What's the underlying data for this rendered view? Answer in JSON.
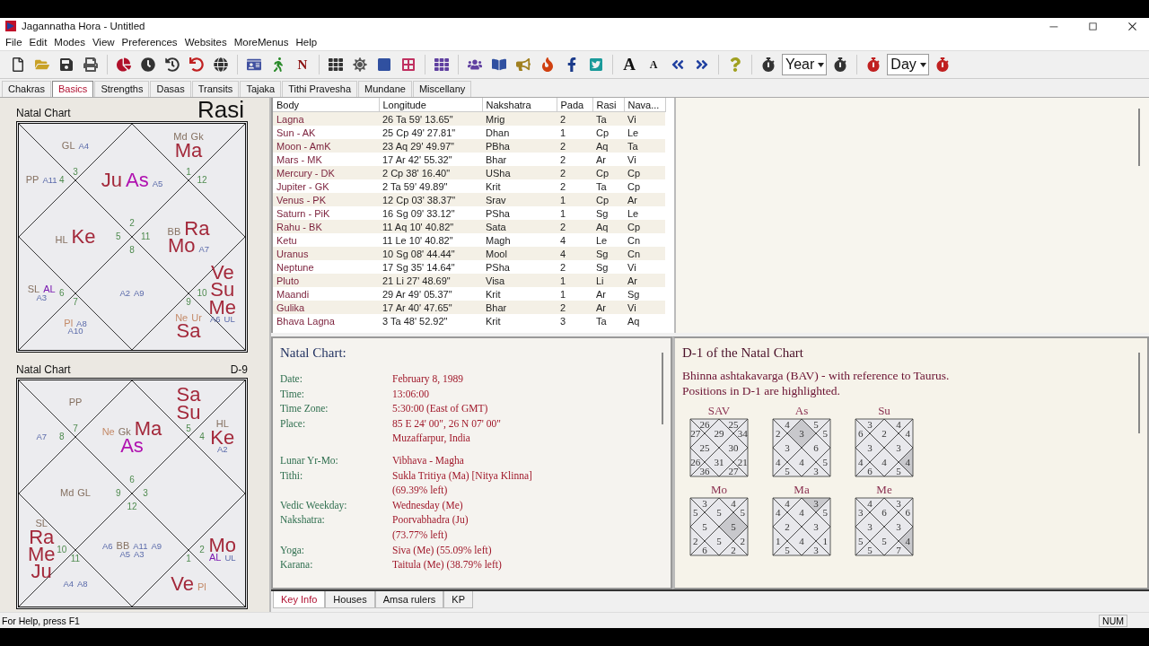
{
  "window": {
    "title": "Jagannatha Hora - Untitled"
  },
  "menu": [
    "File",
    "Edit",
    "Modes",
    "View",
    "Preferences",
    "Websites",
    "MoreMenus",
    "Help"
  ],
  "toolbar": {
    "letter_buttons": [
      "N",
      "A",
      "A"
    ],
    "selects": [
      "Year",
      "Day"
    ]
  },
  "tabs": [
    {
      "label": "Chakras",
      "selected": false
    },
    {
      "label": "Basics",
      "selected": true
    },
    {
      "label": "Strengths",
      "selected": false
    },
    {
      "label": "Dasas",
      "selected": false
    },
    {
      "label": "Transits",
      "selected": false
    },
    {
      "label": "Tajaka",
      "selected": false
    },
    {
      "label": "Tithi Pravesha",
      "selected": false
    },
    {
      "label": "Mundane",
      "selected": false
    },
    {
      "label": "Miscellany",
      "selected": false
    }
  ],
  "charts": [
    {
      "title": "Natal Chart",
      "label": "Rasi",
      "kind": "rasi",
      "houses": {
        "house_1": {
          "sign": "2",
          "items": [
            {
              "text": "Ju",
              "kind": "planet"
            },
            {
              "text": "As",
              "kind": "lagna"
            },
            {
              "text": "A5",
              "kind": "arudha"
            }
          ]
        },
        "house_2": {
          "sign": "3",
          "items": [
            {
              "text": "GL",
              "kind": "special"
            },
            {
              "text": "A4",
              "kind": "arudha"
            }
          ]
        },
        "house_3": {
          "sign": "4",
          "items": [
            {
              "text": "PP",
              "kind": "special"
            },
            {
              "text": "A11",
              "kind": "arudha"
            }
          ]
        },
        "house_4": {
          "sign": "5",
          "items": [
            {
              "text": "HL",
              "kind": "special"
            },
            {
              "text": "Ke",
              "kind": "planet"
            }
          ]
        },
        "house_5": {
          "sign": "6",
          "items": [
            {
              "text": "SL",
              "kind": "special"
            },
            {
              "text": "AL",
              "kind": "al"
            },
            {
              "text": "A3",
              "kind": "arudha"
            }
          ]
        },
        "house_6": {
          "sign": "7",
          "items": [
            {
              "text": "Pl",
              "kind": "outer"
            },
            {
              "text": "A8",
              "kind": "arudha"
            },
            {
              "text": "A10",
              "kind": "arudha"
            }
          ]
        },
        "house_7": {
          "sign": "8",
          "items": [
            {
              "text": "A2",
              "kind": "arudha"
            },
            {
              "text": "A9",
              "kind": "arudha"
            }
          ]
        },
        "house_8": {
          "sign": "9",
          "items": [
            {
              "text": "Ne",
              "kind": "outer"
            },
            {
              "text": "Ur",
              "kind": "outer"
            },
            {
              "text": "Sa",
              "kind": "planet"
            }
          ]
        },
        "house_9": {
          "sign": "10",
          "items": [
            {
              "text": "Ve",
              "kind": "planet"
            },
            {
              "text": "Su",
              "kind": "planet"
            },
            {
              "text": "Me",
              "kind": "planet"
            },
            {
              "text": "A6",
              "kind": "arudha"
            },
            {
              "text": "UL",
              "kind": "arudha"
            }
          ]
        },
        "house_10": {
          "sign": "11",
          "items": [
            {
              "text": "BB",
              "kind": "special"
            },
            {
              "text": "Ra",
              "kind": "planet"
            },
            {
              "text": "Mo",
              "kind": "planet"
            },
            {
              "text": "A7",
              "kind": "arudha"
            }
          ]
        },
        "house_11": {
          "sign": "12"
        },
        "house_12": {
          "sign": "1",
          "items": [
            {
              "text": "Md",
              "kind": "special"
            },
            {
              "text": "Gk",
              "kind": "special"
            },
            {
              "text": "Ma",
              "kind": "planet"
            }
          ]
        }
      }
    },
    {
      "title": "Natal Chart",
      "label": "D-9",
      "kind": "varga",
      "houses": {
        "house_1": {
          "sign": "6",
          "items": [
            {
              "text": "Ne",
              "kind": "outer"
            },
            {
              "text": "Gk",
              "kind": "special"
            },
            {
              "text": "Ma",
              "kind": "planet"
            },
            {
              "text": "As",
              "kind": "lagna"
            }
          ]
        },
        "house_2": {
          "sign": "7",
          "items": [
            {
              "text": "PP",
              "kind": "special"
            }
          ]
        },
        "house_3": {
          "sign": "8",
          "items": [
            {
              "text": "A7",
              "kind": "arudha"
            }
          ]
        },
        "house_4": {
          "sign": "9",
          "items": [
            {
              "text": "Md",
              "kind": "special"
            },
            {
              "text": "GL",
              "kind": "special"
            }
          ]
        },
        "house_5": {
          "sign": "10",
          "items": [
            {
              "text": "SL",
              "kind": "special"
            },
            {
              "text": "Ra",
              "kind": "planet"
            },
            {
              "text": "Me",
              "kind": "planet"
            },
            {
              "text": "Ju",
              "kind": "planet"
            }
          ]
        },
        "house_6": {
          "sign": "11",
          "items": [
            {
              "text": "A4",
              "kind": "arudha"
            },
            {
              "text": "A8",
              "kind": "arudha"
            }
          ]
        },
        "house_7": {
          "sign": "12",
          "items": [
            {
              "text": "A6",
              "kind": "arudha"
            },
            {
              "text": "BB",
              "kind": "special"
            },
            {
              "text": "A11",
              "kind": "arudha"
            },
            {
              "text": "A9",
              "kind": "arudha"
            },
            {
              "text": "A5",
              "kind": "arudha"
            },
            {
              "text": "A3",
              "kind": "arudha"
            }
          ]
        },
        "house_8": {
          "sign": "1",
          "items": [
            {
              "text": "Ve",
              "kind": "planet"
            },
            {
              "text": "Pl",
              "kind": "outer"
            }
          ]
        },
        "house_9": {
          "sign": "2",
          "items": [
            {
              "text": "Mo",
              "kind": "planet"
            },
            {
              "text": "AL",
              "kind": "al"
            },
            {
              "text": "UL",
              "kind": "arudha"
            }
          ]
        },
        "house_10": {
          "sign": "3"
        },
        "house_11": {
          "sign": "4",
          "items": [
            {
              "text": "HL",
              "kind": "special"
            },
            {
              "text": "Ke",
              "kind": "planet"
            },
            {
              "text": "A2",
              "kind": "arudha"
            }
          ]
        },
        "house_12": {
          "sign": "5",
          "items": [
            {
              "text": "Sa",
              "kind": "planet"
            },
            {
              "text": "Su",
              "kind": "planet"
            }
          ]
        }
      }
    }
  ],
  "planet_table": {
    "columns": [
      "Body",
      "Longitude",
      "Nakshatra",
      "Pada",
      "Rasi",
      "Nava..."
    ],
    "rows": [
      [
        "Lagna",
        "26 Ta 59' 13.65\"",
        "Mrig",
        "2",
        "Ta",
        "Vi"
      ],
      [
        "Sun - AK",
        "25 Cp 49' 27.81\"",
        "Dhan",
        "1",
        "Cp",
        "Le"
      ],
      [
        "Moon - AmK",
        "23 Aq 29' 49.97\"",
        "PBha",
        "2",
        "Aq",
        "Ta"
      ],
      [
        "Mars - MK",
        "17 Ar 42' 55.32\"",
        "Bhar",
        "2",
        "Ar",
        "Vi"
      ],
      [
        "Mercury - DK",
        "2 Cp 38' 16.40\"",
        "USha",
        "2",
        "Cp",
        "Cp"
      ],
      [
        "Jupiter - GK",
        "2 Ta 59' 49.89\"",
        "Krit",
        "2",
        "Ta",
        "Cp"
      ],
      [
        "Venus - PK",
        "12 Cp 03' 38.37\"",
        "Srav",
        "1",
        "Cp",
        "Ar"
      ],
      [
        "Saturn - PiK",
        "16 Sg 09' 33.12\"",
        "PSha",
        "1",
        "Sg",
        "Le"
      ],
      [
        "Rahu - BK",
        "11 Aq 10' 40.82\"",
        "Sata",
        "2",
        "Aq",
        "Cp"
      ],
      [
        "Ketu",
        "11 Le 10' 40.82\"",
        "Magh",
        "4",
        "Le",
        "Cn"
      ],
      [
        "Uranus",
        "10 Sg 08' 44.44\"",
        "Mool",
        "4",
        "Sg",
        "Cn"
      ],
      [
        "Neptune",
        "17 Sg 35' 14.64\"",
        "PSha",
        "2",
        "Sg",
        "Vi"
      ],
      [
        "Pluto",
        "21 Li 27' 48.69\"",
        "Visa",
        "1",
        "Li",
        "Ar"
      ],
      [
        "Maandi",
        "29 Ar 49' 05.37\"",
        "Krit",
        "1",
        "Ar",
        "Sg"
      ],
      [
        "Gulika",
        "17 Ar 40' 47.65\"",
        "Bhar",
        "2",
        "Ar",
        "Vi"
      ],
      [
        "Bhava Lagna",
        "3 Ta 48' 52.92\"",
        "Krit",
        "3",
        "Ta",
        "Aq"
      ]
    ]
  },
  "key_info": {
    "title": "Natal Chart:",
    "groups": [
      [
        {
          "label": "Date:",
          "lines": [
            "February 8, 1989"
          ]
        },
        {
          "label": "Time:",
          "lines": [
            "13:06:00"
          ]
        },
        {
          "label": "Time Zone:",
          "lines": [
            "5:30:00 (East of GMT)"
          ]
        },
        {
          "label": "Place:",
          "lines": [
            "85 E 24' 00\", 26 N 07' 00\"",
            "Muzaffarpur, India"
          ]
        }
      ],
      [
        {
          "label": "Lunar Yr-Mo:",
          "lines": [
            "Vibhava - Magha"
          ]
        },
        {
          "label": "Tithi:",
          "lines": [
            "Sukla Tritiya (Ma) [Nitya Klinna]",
            "(69.39% left)"
          ]
        },
        {
          "label": "Vedic Weekday:",
          "lines": [
            "Wednesday (Me)"
          ]
        },
        {
          "label": "Nakshatra:",
          "lines": [
            "Poorvabhadra (Ju)",
            "(73.77% left)"
          ]
        },
        {
          "label": "Yoga:",
          "lines": [
            "Siva (Me) (55.09% left)"
          ]
        },
        {
          "label": "Karana:",
          "lines": [
            "Taitula (Me) (38.79% left)"
          ]
        }
      ]
    ]
  },
  "bav_panel": {
    "title": "D-1 of the Natal Chart",
    "lines": [
      "Bhinna ashtakavarga (BAV) - with reference to Taurus.",
      "Positions in D-1 are highlighted."
    ],
    "charts": [
      {
        "title": "SAV",
        "cells": [
          {
            "value": "29",
            "highlighted": false
          },
          {
            "value": "26",
            "highlighted": false
          },
          {
            "value": "27",
            "highlighted": false
          },
          {
            "value": "25",
            "highlighted": false
          },
          {
            "value": "26",
            "highlighted": false
          },
          {
            "value": "36",
            "highlighted": false
          },
          {
            "value": "31",
            "highlighted": false
          },
          {
            "value": "27",
            "highlighted": false
          },
          {
            "value": "21",
            "highlighted": false
          },
          {
            "value": "30",
            "highlighted": false
          },
          {
            "value": "34",
            "highlighted": false
          },
          {
            "value": "25",
            "highlighted": false
          }
        ]
      },
      {
        "title": "As",
        "cells": [
          {
            "value": "3",
            "highlighted": true
          },
          {
            "value": "4",
            "highlighted": false
          },
          {
            "value": "2",
            "highlighted": false
          },
          {
            "value": "3",
            "highlighted": false
          },
          {
            "value": "4",
            "highlighted": false
          },
          {
            "value": "5",
            "highlighted": false
          },
          {
            "value": "4",
            "highlighted": false
          },
          {
            "value": "3",
            "highlighted": false
          },
          {
            "value": "5",
            "highlighted": false
          },
          {
            "value": "6",
            "highlighted": false
          },
          {
            "value": "5",
            "highlighted": false
          },
          {
            "value": "5",
            "highlighted": false
          }
        ]
      },
      {
        "title": "Su",
        "cells": [
          {
            "value": "2",
            "highlighted": false
          },
          {
            "value": "3",
            "highlighted": false
          },
          {
            "value": "6",
            "highlighted": false
          },
          {
            "value": "3",
            "highlighted": false
          },
          {
            "value": "4",
            "highlighted": false
          },
          {
            "value": "6",
            "highlighted": false
          },
          {
            "value": "4",
            "highlighted": false
          },
          {
            "value": "5",
            "highlighted": false
          },
          {
            "value": "4",
            "highlighted": true
          },
          {
            "value": "3",
            "highlighted": false
          },
          {
            "value": "4",
            "highlighted": false
          },
          {
            "value": "4",
            "highlighted": false
          }
        ]
      },
      {
        "title": "Mo",
        "cells": [
          {
            "value": "5",
            "highlighted": false
          },
          {
            "value": "3",
            "highlighted": false
          },
          {
            "value": "5",
            "highlighted": false
          },
          {
            "value": "5",
            "highlighted": false
          },
          {
            "value": "2",
            "highlighted": false
          },
          {
            "value": "6",
            "highlighted": false
          },
          {
            "value": "5",
            "highlighted": false
          },
          {
            "value": "2",
            "highlighted": false
          },
          {
            "value": "2",
            "highlighted": false
          },
          {
            "value": "5",
            "highlighted": true
          },
          {
            "value": "5",
            "highlighted": false
          },
          {
            "value": "4",
            "highlighted": false
          }
        ]
      },
      {
        "title": "Ma",
        "cells": [
          {
            "value": "4",
            "highlighted": false
          },
          {
            "value": "4",
            "highlighted": false
          },
          {
            "value": "4",
            "highlighted": false
          },
          {
            "value": "2",
            "highlighted": false
          },
          {
            "value": "1",
            "highlighted": false
          },
          {
            "value": "5",
            "highlighted": false
          },
          {
            "value": "4",
            "highlighted": false
          },
          {
            "value": "3",
            "highlighted": false
          },
          {
            "value": "1",
            "highlighted": false
          },
          {
            "value": "3",
            "highlighted": false
          },
          {
            "value": "5",
            "highlighted": false
          },
          {
            "value": "3",
            "highlighted": true
          }
        ]
      },
      {
        "title": "Me",
        "cells": [
          {
            "value": "6",
            "highlighted": false
          },
          {
            "value": "4",
            "highlighted": false
          },
          {
            "value": "3",
            "highlighted": false
          },
          {
            "value": "3",
            "highlighted": false
          },
          {
            "value": "5",
            "highlighted": false
          },
          {
            "value": "5",
            "highlighted": false
          },
          {
            "value": "5",
            "highlighted": false
          },
          {
            "value": "7",
            "highlighted": false
          },
          {
            "value": "4",
            "highlighted": true
          },
          {
            "value": "3",
            "highlighted": false
          },
          {
            "value": "6",
            "highlighted": false
          },
          {
            "value": "3",
            "highlighted": false
          }
        ]
      }
    ]
  },
  "bottom_tabs": [
    {
      "label": "Key Info",
      "selected": true
    },
    {
      "label": "Houses",
      "selected": false
    },
    {
      "label": "Amsa rulers",
      "selected": false
    },
    {
      "label": "KP",
      "selected": false
    }
  ],
  "status_bar": {
    "help": "For Help, press F1",
    "indicators": [
      "NUM"
    ]
  }
}
